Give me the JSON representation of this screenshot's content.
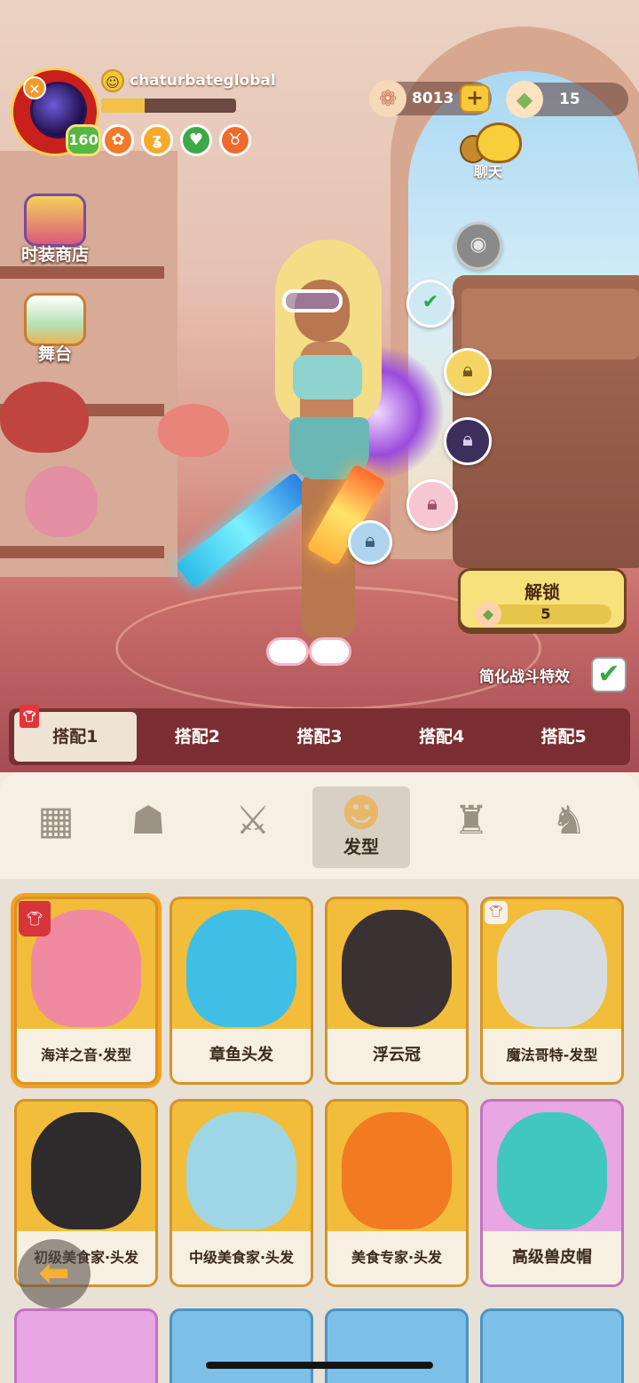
{
  "player": {
    "name": "chaturbateglobal",
    "level": "160",
    "xp_fraction": 0.32
  },
  "currencies": {
    "shells": "8013",
    "gems": "15"
  },
  "buttons": {
    "chat": "聊天",
    "fashion_shop": "时装商店",
    "stage": "舞台",
    "unlock": "解锁",
    "unlock_cost": "5",
    "simplify_effects": "简化战斗特效",
    "add": "+"
  },
  "settings": {
    "simplify_effects_checked": true
  },
  "loadouts": [
    "搭配1",
    "搭配2",
    "搭配3",
    "搭配4",
    "搭配5"
  ],
  "active_loadout": 0,
  "categories": {
    "active_label": "发型",
    "icons": [
      "grid-icon",
      "face-mask-icon",
      "weapon-icon",
      "hair-icon",
      "hat-icon",
      "outfit-icon"
    ]
  },
  "items": [
    {
      "name": "海洋之音·发型",
      "color": "#f08aa0",
      "badge": "shirt"
    },
    {
      "name": "章鱼头发",
      "color": "#3fbfe6",
      "badge": ""
    },
    {
      "name": "浮云冠",
      "color": "#3a3132",
      "badge": ""
    },
    {
      "name": "魔法哥特-发型",
      "color": "#d7dce0",
      "badge": "small"
    },
    {
      "name": "初级美食家·头发",
      "color": "#2d2b2b",
      "badge": ""
    },
    {
      "name": "中级美食家·头发",
      "color": "#9fd6e6",
      "badge": ""
    },
    {
      "name": "美食专家·头发",
      "color": "#f27a22",
      "badge": ""
    },
    {
      "name": "高级兽皮帽",
      "color": "#3fc7c0",
      "badge": "",
      "rare": true
    }
  ],
  "colors": {
    "accent": "#f1bd3b",
    "rare": "#e8a6e3",
    "loadout_bar": "#7a2e31"
  }
}
